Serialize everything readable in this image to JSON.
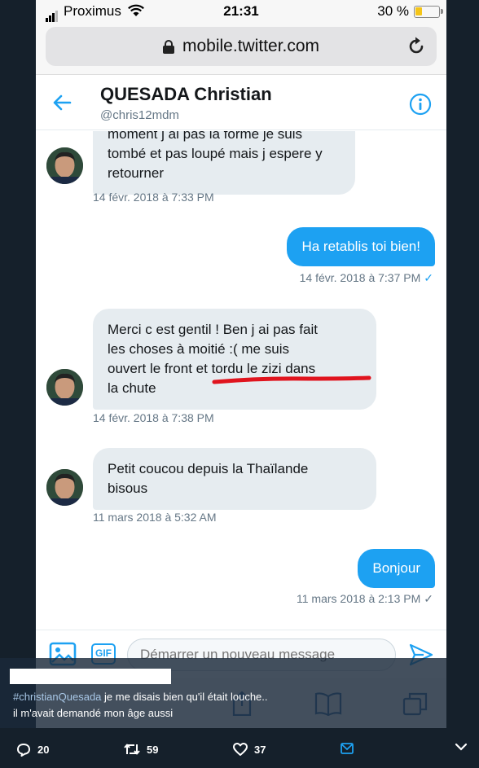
{
  "status_bar": {
    "carrier": "Proximus",
    "time": "21:31",
    "battery": "30 %",
    "battery_level": 0.3
  },
  "browser": {
    "url": "mobile.twitter.com"
  },
  "conversation": {
    "name": "QUESADA Christian",
    "handle": "@chris12mdm"
  },
  "messages": [
    {
      "from": "them",
      "text": "moment j ai pas la forme je suis tombé et pas loupé mais j espere y retourner",
      "time": "14 févr. 2018 à 7:33 PM"
    },
    {
      "from": "me",
      "text": "Ha retablis toi bien!",
      "time": "14 févr. 2018 à 7:37 PM"
    },
    {
      "from": "them",
      "text": "Merci c est gentil ! Ben j ai pas fait les choses à moitié :( me suis ouvert le front et tordu le zizi dans la chute",
      "time": "14 févr. 2018 à 7:38 PM"
    },
    {
      "from": "them",
      "text": "Petit coucou depuis la Thaïlande bisous",
      "time": "11 mars 2018 à 5:32 AM"
    },
    {
      "from": "me",
      "text": "Bonjour",
      "time": "11 mars 2018 à 2:13 PM"
    }
  ],
  "message_lines": {
    "m0": [
      "moment j ai pas la forme je suis",
      "tombé et pas loupé mais j espere y",
      "retourner"
    ],
    "m2": [
      "Merci c est gentil ! Ben j ai pas fait",
      "les choses à moitié :( me suis",
      "ouvert le front et tordu le zizi dans",
      "la chute"
    ],
    "m3": [
      "Petit coucou depuis la Thaïlande",
      "bisous"
    ]
  },
  "composer": {
    "gif_label": "GIF",
    "placeholder": "Démarrer un nouveau message"
  },
  "caption": {
    "hashtag": "#christianQuesada",
    "line1_rest": " je me disais bien qu'il était louche..",
    "line2": "il m'avait demandé mon âge aussi"
  },
  "tweet_actions": {
    "replies": "20",
    "retweets": "59",
    "likes": "37"
  },
  "colors": {
    "accent": "#1da1f2",
    "bubble_in": "#e6ecf0",
    "underline": "#e0141e",
    "dark_bg": "#15202b"
  }
}
